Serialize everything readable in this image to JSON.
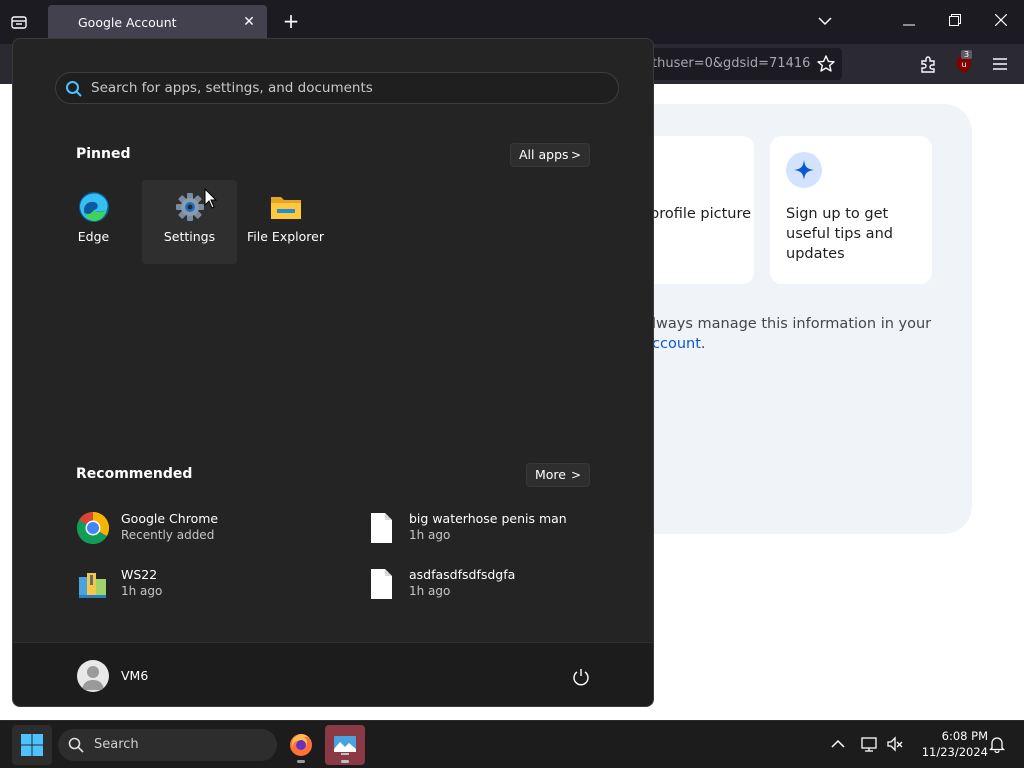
{
  "browser": {
    "tab_title": "Google Account",
    "url_fragment": "thuser=0&gdsid=71416",
    "ublock_count": "3"
  },
  "page": {
    "tile1_text": "profile picture",
    "tile2_text_lines": [
      "Sign up to get",
      "useful tips and",
      "updates"
    ],
    "manage_line1": "lways manage this information in your",
    "manage_link": "ccount",
    "manage_period": "."
  },
  "start_menu": {
    "search_placeholder": "Search for apps, settings, and documents",
    "pinned_title": "Pinned",
    "all_apps_label": "All apps",
    "pinned_apps": [
      {
        "label": "Edge",
        "icon": "edge-icon"
      },
      {
        "label": "Settings",
        "icon": "gear-icon"
      },
      {
        "label": "File Explorer",
        "icon": "folder-icon"
      }
    ],
    "recommended_title": "Recommended",
    "more_label": "More",
    "recommended": [
      {
        "name": "Google Chrome",
        "sub": "Recently added",
        "icon": "chrome-icon"
      },
      {
        "name": "big waterhose penis man",
        "sub": "1h ago",
        "icon": "document-icon"
      },
      {
        "name": "WS22",
        "sub": "1h ago",
        "icon": "zip-folder-icon"
      },
      {
        "name": "asdfasdfsdfsdgfa",
        "sub": "1h ago",
        "icon": "document-icon"
      }
    ],
    "user_name": "VM6"
  },
  "taskbar": {
    "search_label": "Search",
    "time": "6:08 PM",
    "date": "11/23/2024"
  }
}
